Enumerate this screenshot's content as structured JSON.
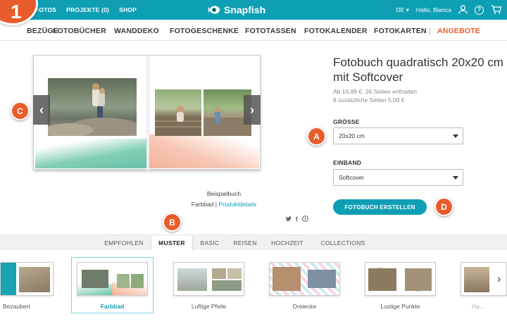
{
  "topbar": {
    "nav": [
      "FOTOS",
      "PROJEKTE (0)",
      "SHOP"
    ],
    "brand": "Snapfish",
    "language": "DE",
    "greeting": "Hallo, Bianca",
    "step_number": "1",
    "icons": [
      "user-icon",
      "help-icon",
      "cart-icon"
    ]
  },
  "categories": [
    "BEZÜGE",
    "FOTOBÜCHER",
    "WANDDEKO",
    "FOTOGESCHENKE",
    "FOTOTASSEN",
    "FOTOKALENDER",
    "FOTOKARTEN",
    "|",
    "ANGEBOTE"
  ],
  "markers": {
    "a": "A",
    "b": "B",
    "c": "C",
    "d": "D"
  },
  "preview": {
    "caption_line1": "Beispielbuch",
    "style_name": "Farbbad",
    "separator": "|",
    "details_link": "Produktdetails",
    "prev_icon": "chevron-left-icon",
    "next_icon": "chevron-right-icon"
  },
  "social": [
    "twitter-icon",
    "facebook-icon",
    "pinterest-icon"
  ],
  "product": {
    "title": "Fotobuch quadratisch 20x20 cm mit Softcover",
    "price_line1": "Ab 19,99 €, 26 Seiten enthalten",
    "price_line2": "8 zusätzliche Seiten 5,00 €",
    "size_label": "GRÖSSE",
    "size_value": "20x20 cm",
    "binding_label": "EINBAND",
    "binding_value": "Softcover",
    "cta": "FOTOBUCH ERSTELLEN"
  },
  "tabs": [
    "EMPFOHLEN",
    "MUSTER",
    "BASIC",
    "REISEN",
    "HOCHZEIT",
    "COLLECTIONS"
  ],
  "active_tab": "MUSTER",
  "themes": [
    "Bezaubert",
    "Farbbad",
    "Luftige Pfeile",
    "Dreiecke",
    "Lustige Punkte",
    "Ha..."
  ],
  "selected_theme": "Farbbad",
  "colors": {
    "brand": "#0f9fb5",
    "accent": "#ea5b2b"
  }
}
